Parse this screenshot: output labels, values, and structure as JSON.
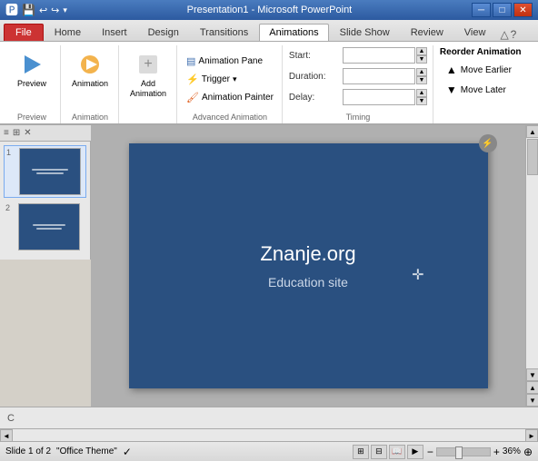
{
  "titlebar": {
    "title": "Presentation1 - Microsoft PowerPoint",
    "quickaccess": [
      "💾",
      "↩",
      "↪",
      "▾"
    ]
  },
  "tabs": {
    "items": [
      "File",
      "Home",
      "Insert",
      "Design",
      "Transitions",
      "Animations",
      "Slide Show",
      "Review",
      "View"
    ],
    "active": "Animations"
  },
  "ribbon": {
    "groups": {
      "preview": {
        "label": "Preview",
        "btn_label": "Preview"
      },
      "animation": {
        "label": "Animation",
        "btn_label": "Animation"
      },
      "add_animation": {
        "label": "",
        "btn_label": "Add\nAnimation"
      },
      "advanced": {
        "label": "Advanced Animation",
        "animation_pane": "Animation Pane",
        "trigger": "Trigger",
        "trigger_arrow": "▾",
        "animation_painter": "Animation Painter"
      },
      "timing": {
        "label": "Timing",
        "start_label": "Start:",
        "duration_label": "Duration:",
        "delay_label": "Delay:"
      },
      "reorder": {
        "label": "",
        "title": "Reorder Animation",
        "move_earlier": "Move Earlier",
        "move_later": "Move Later"
      }
    }
  },
  "slides": [
    {
      "num": "1",
      "active": true
    },
    {
      "num": "2",
      "active": false
    }
  ],
  "slide": {
    "title": "Znanje.org",
    "subtitle": "Education site"
  },
  "statusbar": {
    "slide_info": "Slide 1 of 2",
    "theme": "\"Office Theme\"",
    "zoom": "36%"
  }
}
